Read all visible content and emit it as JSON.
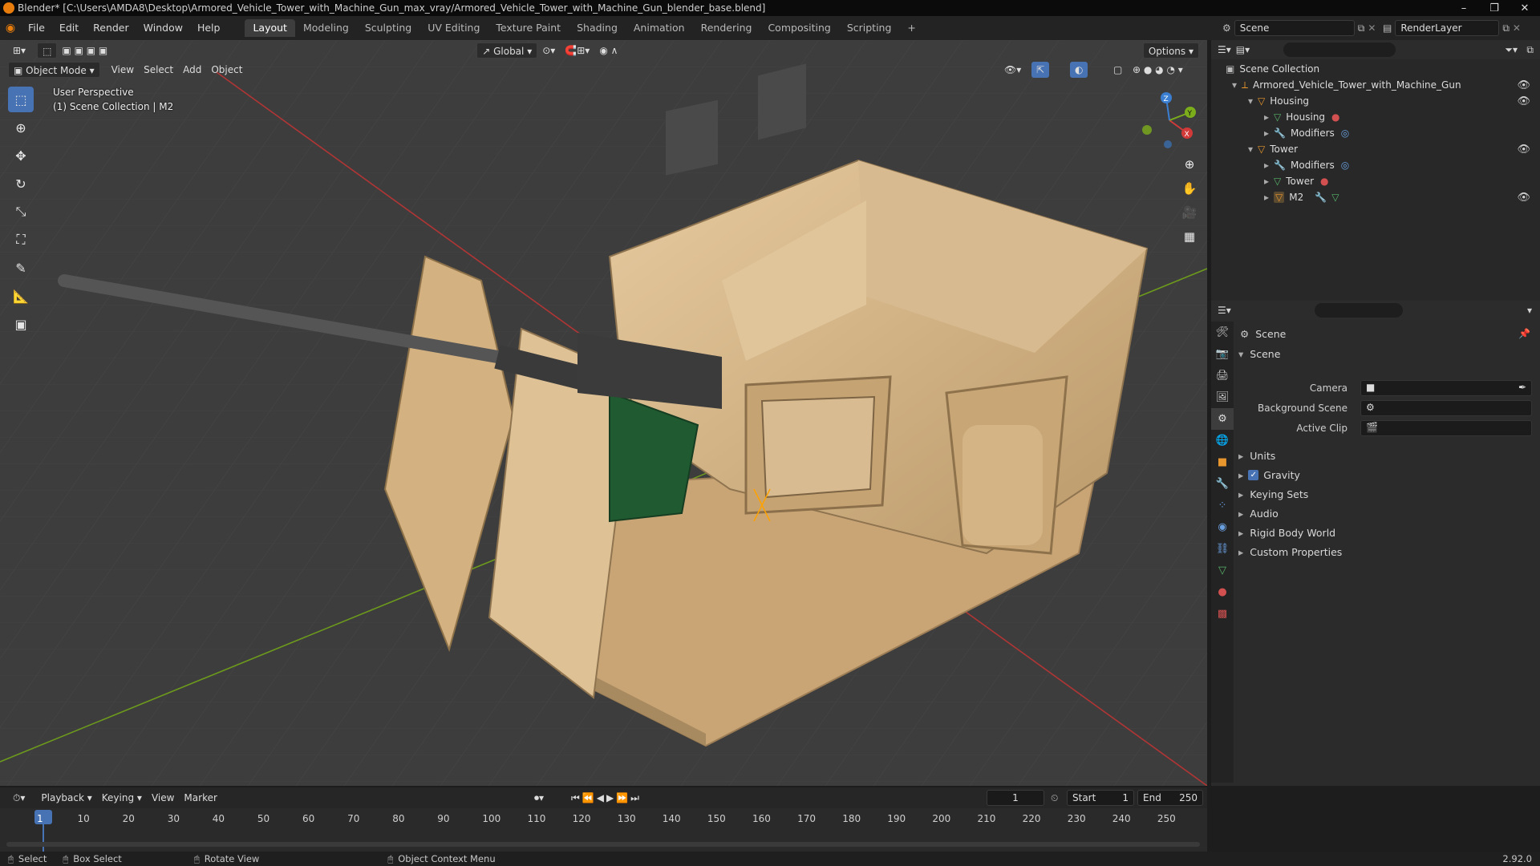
{
  "window": {
    "title": "Blender* [C:\\Users\\AMDA8\\Desktop\\Armored_Vehicle_Tower_with_Machine_Gun_max_vray/Armored_Vehicle_Tower_with_Machine_Gun_blender_base.blend]",
    "controls": [
      "–",
      "❐",
      "✕"
    ]
  },
  "menu": {
    "items": [
      "File",
      "Edit",
      "Render",
      "Window",
      "Help"
    ],
    "workspaces": [
      "Layout",
      "Modeling",
      "Sculpting",
      "UV Editing",
      "Texture Paint",
      "Shading",
      "Animation",
      "Rendering",
      "Compositing",
      "Scripting",
      "+"
    ],
    "active_workspace": "Layout",
    "scene": "Scene",
    "render_layer": "RenderLayer"
  },
  "viewport": {
    "mode": "Object Mode",
    "menus": [
      "View",
      "Select",
      "Add",
      "Object"
    ],
    "transform": "Global",
    "options": "Options",
    "info_line1": "User Perspective",
    "info_line2": "(1) Scene Collection | M2",
    "gizmo": {
      "x": "X",
      "y": "Y",
      "z": "Z"
    }
  },
  "outliner": {
    "root": "Scene Collection",
    "rows": [
      {
        "label": "Armored_Vehicle_Tower_with_Machine_Gun",
        "indent": 1
      },
      {
        "label": "Housing",
        "indent": 2
      },
      {
        "label": "Housing",
        "indent": 3
      },
      {
        "label": "Modifiers",
        "indent": 3
      },
      {
        "label": "Tower",
        "indent": 2
      },
      {
        "label": "Modifiers",
        "indent": 3
      },
      {
        "label": "Tower",
        "indent": 3
      },
      {
        "label": "M2",
        "indent": 3
      }
    ]
  },
  "properties": {
    "context": "Scene",
    "panel": "Scene",
    "fields": {
      "camera": "Camera",
      "background_scene": "Background Scene",
      "active_clip": "Active Clip"
    },
    "subpanels": [
      "Units",
      "Gravity",
      "Keying Sets",
      "Audio",
      "Rigid Body World",
      "Custom Properties"
    ],
    "gravity_checked": true
  },
  "timeline": {
    "menus": [
      "Playback",
      "Keying",
      "View",
      "Marker"
    ],
    "current_frame": "1",
    "start_label": "Start",
    "start": "1",
    "end_label": "End",
    "end": "250",
    "ruler": [
      "1",
      "10",
      "20",
      "30",
      "40",
      "50",
      "60",
      "70",
      "80",
      "90",
      "100",
      "110",
      "120",
      "130",
      "140",
      "150",
      "160",
      "170",
      "180",
      "190",
      "200",
      "210",
      "220",
      "230",
      "240",
      "250"
    ]
  },
  "statusbar": {
    "select": "Select",
    "box_select": "Box Select",
    "rotate_view": "Rotate View",
    "context_menu": "Object Context Menu",
    "version": "2.92.0"
  },
  "colors": {
    "accent": "#4772b3",
    "blender_orange": "#e87d0d",
    "axis_x": "#d23a3a",
    "axis_y": "#7cae1c",
    "axis_z": "#3a7fd2",
    "model": "#d9b88c"
  }
}
